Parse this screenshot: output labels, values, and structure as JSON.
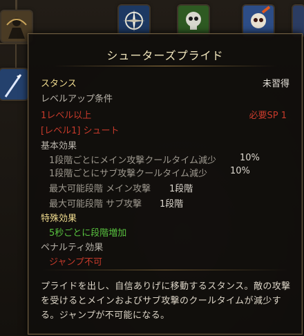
{
  "tooltip": {
    "title": "シューターズプライド",
    "stance_label": "スタンス",
    "status": "未習得",
    "req_header": "レベルアップ条件",
    "req_level": "1レベル以上",
    "req_sp": "必要SP 1",
    "req_link": "[レベル1] シュート",
    "base_header": "基本効果",
    "base_effects": [
      {
        "label": "1段階ごとにメイン攻撃クールタイム減少",
        "value": "10%"
      },
      {
        "label": "1段階ごとにサブ攻撃クールタイム減少",
        "value": "10%"
      },
      {
        "label": "最大可能段階 メイン攻撃",
        "value": "1段階"
      },
      {
        "label": "最大可能段階 サブ攻撃",
        "value": "1段階"
      }
    ],
    "special_header": "特殊効果",
    "special_effect": "5秒ごとに段階増加",
    "penalty_header": "ペナルティ効果",
    "penalty_effect": "ジャンプ不可",
    "description": "プライドを出し、自信ありげに移動するスタンス。敵の攻撃を受けるとメインおよびサブ攻撃のクールタイムが減少する。ジャンプが不可能になる。"
  },
  "icons": [
    "archer-skill-icon",
    "compass-skill-icon",
    "skull-green-skill-icon",
    "skull-fire-skill-icon",
    "arrow-skill-icon"
  ],
  "colors": {
    "title": "#f2e7bd",
    "header": "#f1dc8f",
    "unmet": "#c73a2b",
    "special": "#58c23f",
    "border": "#6b5a3e"
  }
}
